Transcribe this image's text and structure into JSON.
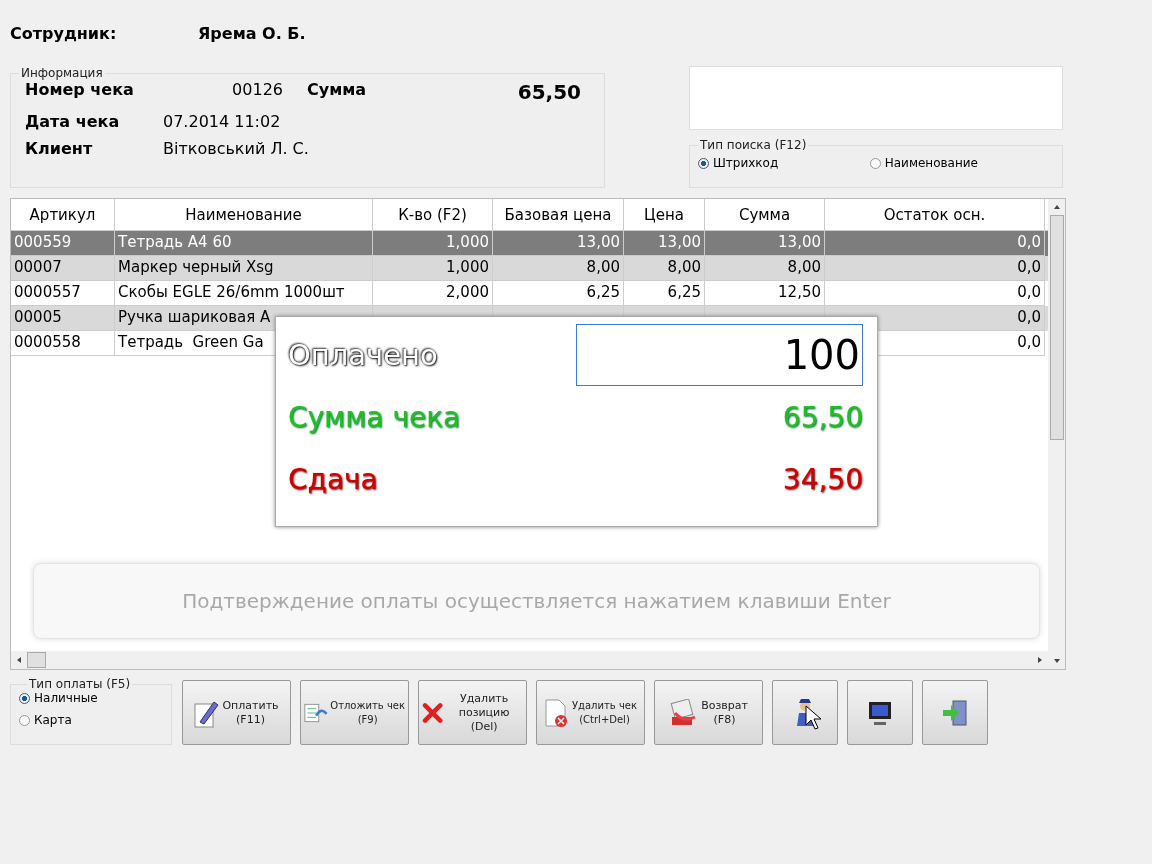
{
  "employee": {
    "label": "Сотрудник:",
    "value": "Ярема О. Б."
  },
  "info": {
    "title": "Информация",
    "receipt_label": "Номер чека",
    "receipt_number": "00126",
    "sum_label": "Сумма",
    "sum_value": "65,50",
    "date_label": "Дата чека",
    "date_value": "07.2014 11:02",
    "client_label": "Клиент",
    "client_value": "Вітковський Л. С."
  },
  "search_type": {
    "title": "Тип поиска (F12)",
    "options": [
      {
        "label": "Штрихкод",
        "selected": true
      },
      {
        "label": "Наименование",
        "selected": false
      }
    ]
  },
  "table": {
    "columns": [
      "Артикул",
      "Наименование",
      "К-во (F2)",
      "Базовая цена",
      "Цена",
      "Сумма",
      "Остаток осн."
    ],
    "rows": [
      {
        "selected": true,
        "cells": [
          "000559",
          "Тетрадь А4 60",
          "1,000",
          "13,00",
          "13,00",
          "13,00",
          "0,0"
        ]
      },
      {
        "selected": false,
        "cells": [
          "00007",
          "Маркер черный Xsg",
          "1,000",
          "8,00",
          "8,00",
          "8,00",
          "0,0"
        ]
      },
      {
        "selected": false,
        "cells": [
          "0000557",
          "Скобы EGLE 26/6mm 1000шт",
          "2,000",
          "6,25",
          "6,25",
          "12,50",
          "0,0"
        ]
      },
      {
        "selected": false,
        "cells": [
          "00005",
          "Ручка шариковая A",
          "",
          "",
          "",
          "",
          "0,0"
        ]
      },
      {
        "selected": false,
        "cells": [
          "0000558",
          "Тетрадь  Green Ga",
          "",
          "",
          "",
          "",
          "0,0"
        ]
      }
    ]
  },
  "hint": "Подтверждение оплаты осуществляется нажатием клавиши Enter",
  "payment_dialog": {
    "paid_label": "Оплачено",
    "paid_value": "100",
    "total_label": "Сумма чека",
    "total_value": "65,50",
    "change_label": "Сдача",
    "change_value": "34,50"
  },
  "payment_type": {
    "title": "Тип оплаты (F5)",
    "options": [
      {
        "label": "Наличные",
        "selected": true
      },
      {
        "label": "Карта",
        "selected": false
      }
    ]
  },
  "buttons": [
    {
      "kind": "pay",
      "label": "Оплатить",
      "key": "(F11)"
    },
    {
      "kind": "defer",
      "label": "Отложить чек",
      "key": "(F9)"
    },
    {
      "kind": "delete-item",
      "label": "Удалить позицию",
      "key": "(Del)"
    },
    {
      "kind": "delete-receipt",
      "label": "Удалить чек",
      "key": "(Ctrl+Del)"
    },
    {
      "kind": "return",
      "label": "Возврат",
      "key": "(F8)"
    },
    {
      "kind": "user"
    },
    {
      "kind": "monitor"
    },
    {
      "kind": "exit"
    }
  ]
}
